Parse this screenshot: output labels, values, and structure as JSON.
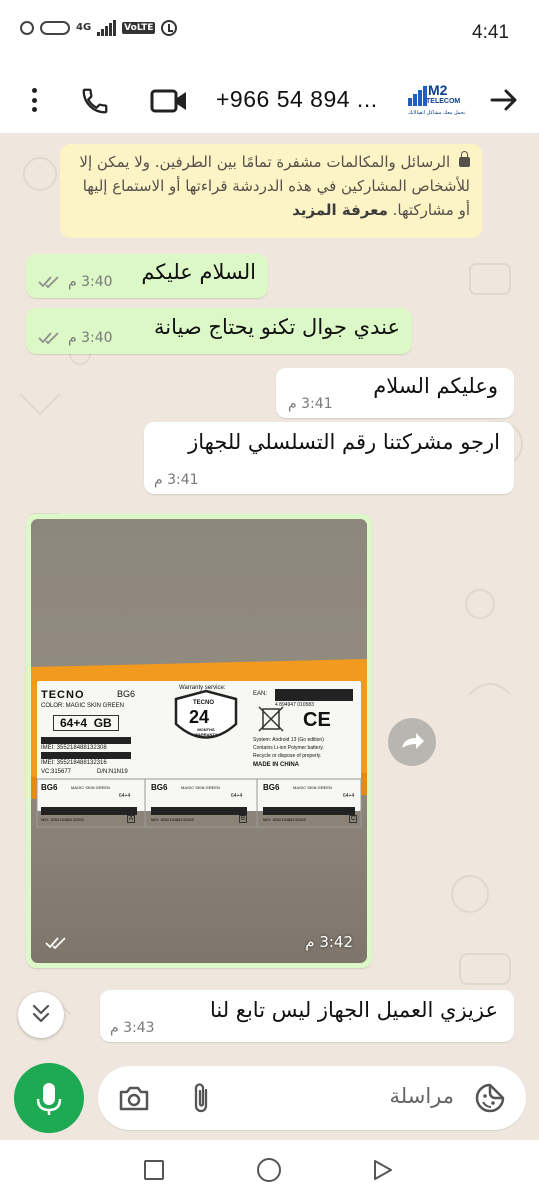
{
  "status_bar": {
    "time": "4:41",
    "network": "4G",
    "volte": "VoLTE"
  },
  "header": {
    "contact_name": "+966 54 894 ...",
    "avatar": {
      "brand": "M2",
      "sub": "TELECOM",
      "tagline": "نحمل معك مشاكل اتصالاتك"
    },
    "icons": [
      "more-vert-icon",
      "phone-icon",
      "video-call-icon",
      "arrow-back-icon"
    ]
  },
  "notice": {
    "text": "الرسائل والمكالمات مشفرة تمامًا بين الطرفين. ولا يمكن إلا للأشخاص المشاركين في هذه الدردشة قراءتها أو الاستماع إليها أو مشاركتها.",
    "link": "معرفة المزيد"
  },
  "messages": [
    {
      "direction": "out",
      "text": "السلام عليكم",
      "time": "3:40 م",
      "status": "read"
    },
    {
      "direction": "out",
      "text": "عندي جوال تكنو يحتاج صيانة",
      "time": "3:40 م",
      "status": "read"
    },
    {
      "direction": "in",
      "text": "وعليكم السلام",
      "time": "3:41 م"
    },
    {
      "direction": "in",
      "text": "ارجو مشركتنا رقم التسلسلي للجهاز",
      "time": "3:41 م"
    },
    {
      "direction": "out",
      "type": "image",
      "time": "3:42 م",
      "status": "read"
    },
    {
      "direction": "in",
      "text": "عزيزي العميل الجهاز ليس تابع لنا",
      "time": "3:43 م"
    }
  ],
  "photo": {
    "brand": "TECNO",
    "model": "BG6",
    "color_label": "COLOR: MAGIC SKIN GREEN",
    "storage": "64+4  GB",
    "imei_1": "IMEI: 355218488132308",
    "imei_2": "IMEI: 355218488132316",
    "vc": "VC:315677",
    "dn": "D/N:N1N19",
    "warranty_label": "Warranty service:",
    "warranty_brand": "TECNO",
    "warranty_months": "24",
    "warranty_caption": "MONTHS WARRANTY",
    "ean_label": "EAN:",
    "ean_code": "4 894947 010583",
    "ce_mark": "CE",
    "system_line": "System: Android 13 (Go edition)",
    "battery_line": "Contains Li-ion Polymer battery.",
    "recycle_line": "Recycle or dispose of properly.",
    "made_in": "MADE IN CHINA",
    "sticker_model": "BG6",
    "sticker_color": "MAGIC SKIN GREEN",
    "sticker_storage": "64+4",
    "sticker_imei": "MEI: 355218488132308",
    "sticker_letters": [
      "A",
      "B",
      "C"
    ]
  },
  "composer": {
    "placeholder": "مراسلة"
  },
  "colors": {
    "outgoing_bubble": "#dcf8c6",
    "incoming_bubble": "#ffffff",
    "chat_background": "#efe7dd",
    "mic_button": "#1eaa52",
    "notice_background": "#fdf4c5",
    "read_ticks": "#8e8e8e"
  }
}
